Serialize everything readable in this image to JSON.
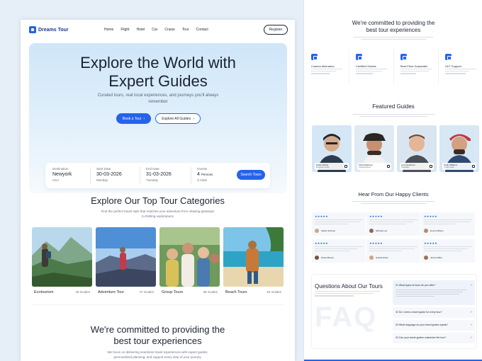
{
  "nav": {
    "logo": "Dreams Tour",
    "items": [
      "Home",
      "Flight",
      "Hotel",
      "Car",
      "Cruise",
      "Tour",
      "Contact"
    ],
    "register": "Register"
  },
  "hero": {
    "title_line1": "Explore the World with",
    "title_line2": "Expert Guides",
    "subtitle": "Curated tours, real local experiences, and journeys you'll always remember",
    "book_button": "Book a Tour",
    "explore_button": "Explore All Guides"
  },
  "search": {
    "destination": {
      "label": "Destination",
      "value": "Newyork",
      "sub": "USA"
    },
    "start": {
      "label": "Start Date",
      "value": "30-03-2026",
      "sub": "Monday"
    },
    "end": {
      "label": "End Date",
      "value": "31-03-2026",
      "sub": "Tuesday"
    },
    "guests": {
      "label": "Guests",
      "value": "4",
      "unit": "Persons",
      "sub": "3 Adult"
    },
    "button": "Search Tours"
  },
  "categories": {
    "title": "Explore Our Top Tour Categories",
    "subtitle": "Find the perfect travel style that matches your adventure from relaxing getaways to thrilling explorations",
    "items": [
      {
        "name": "Ecotourism",
        "count": "25 Guides"
      },
      {
        "name": "Adventure Tour",
        "count": "47 Guides"
      },
      {
        "name": "Group Tours",
        "count": "38 Guides"
      },
      {
        "name": "Beach Tours",
        "count": "54 Guides"
      }
    ]
  },
  "commitment": {
    "title_line1": "We're committed to providing the",
    "title_line2": "best tour experiences",
    "subtitle": "We focus on delivering seamless travel experiences with expert guides, personalized planning, and support every step of your journey."
  },
  "right": {
    "commit_title_line1": "We're committed to providing the",
    "commit_title_line2": "best tour experiences",
    "features": [
      {
        "title": "Custom Itineraries"
      },
      {
        "title": "Certified Guides"
      },
      {
        "title": "Best Price Guarantee"
      },
      {
        "title": "24/7 Support"
      }
    ],
    "guides_title": "Featured Guides",
    "guides": [
      {
        "name": "Ethan Parker",
        "role": "Mountain Guide"
      },
      {
        "name": "Olivia Martinez",
        "role": "Cultural Expert"
      },
      {
        "name": "Liam Anderson",
        "role": "Specialist"
      },
      {
        "name": "Noah Williams",
        "role": "Travel Guide"
      }
    ],
    "clients_title": "Hear From Our Happy Clients",
    "reviews": [
      {
        "name": "Sarah Johnson"
      },
      {
        "name": "Michael Lee"
      },
      {
        "name": "Emma Wilson"
      },
      {
        "name": "Daniel Brown"
      },
      {
        "name": "Sophia Davis"
      },
      {
        "name": "James Miller"
      }
    ],
    "faq": {
      "title": "Questions About Our Tours",
      "watermark": "FAQ",
      "questions": [
        "01 What types of tours do you offer?",
        "02 Do I need a travel guide for every tour?",
        "03 What language do your travel guides speak?",
        "04 Can your travel guides customize the tour?"
      ]
    }
  },
  "colors": {
    "accent": "#2563eb",
    "text": "#1c2333",
    "muted": "#6b7280",
    "background": "#e6eef7"
  }
}
